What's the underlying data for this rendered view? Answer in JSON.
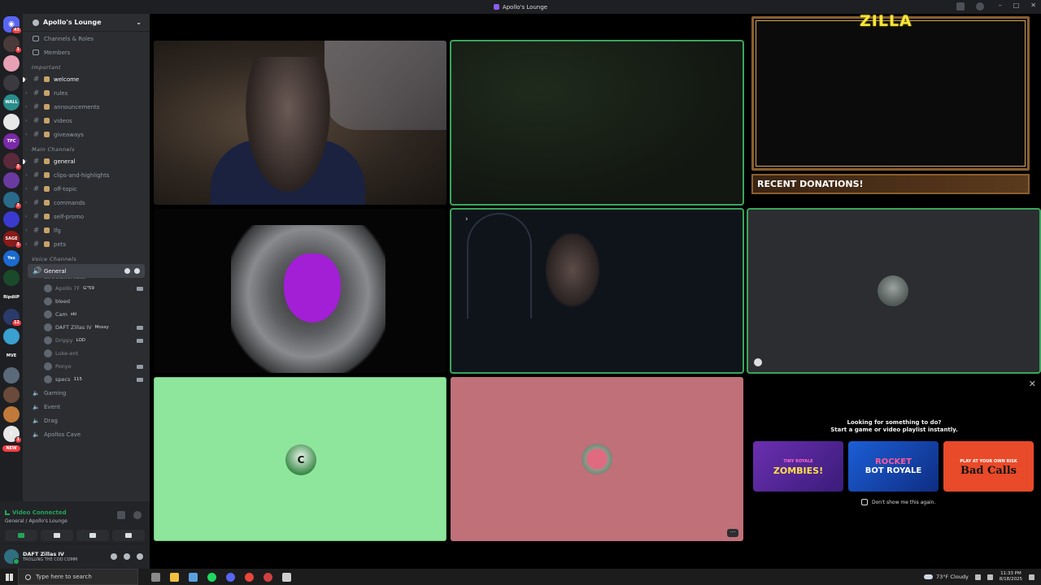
{
  "window": {
    "title": "Apollo's Lounge"
  },
  "server_rail": {
    "home_badge": "43",
    "items": [
      {
        "label": "",
        "badge": "1",
        "color": "#4b3a3a"
      },
      {
        "label": "",
        "badge": "",
        "color": "#e8a0b4"
      },
      {
        "label": "",
        "badge": "",
        "color": "#3a3a40"
      },
      {
        "label": "WALL",
        "badge": "",
        "color": "#2a8c8c"
      },
      {
        "label": "",
        "badge": "",
        "color": "#e8e8e8"
      },
      {
        "label": "TPC",
        "badge": "",
        "color": "#7a2aa8"
      },
      {
        "label": "",
        "badge": "3",
        "color": "#5a2a3a"
      },
      {
        "label": "",
        "badge": "",
        "color": "#6a3aa0"
      },
      {
        "label": "",
        "badge": "3",
        "color": "#2a6a8a"
      },
      {
        "label": "",
        "badge": "",
        "color": "#3a3ad0"
      },
      {
        "label": "SAGE",
        "badge": "3",
        "color": "#8a1a1a"
      },
      {
        "label": "Yes",
        "badge": "",
        "color": "#1a6ad0"
      },
      {
        "label": "",
        "badge": "",
        "color": "#1a4a2a"
      },
      {
        "label": "RipdiiP",
        "badge": "",
        "color": "#1e1f22"
      },
      {
        "label": "",
        "badge": "12",
        "color": "#2a3a6a"
      },
      {
        "label": "",
        "badge": "",
        "color": "#3aa0d0"
      },
      {
        "label": "MVE",
        "badge": "",
        "color": "#1e1f22"
      },
      {
        "label": "",
        "badge": "",
        "color": "#5a6a7a"
      },
      {
        "label": "",
        "badge": "",
        "color": "#6a4a3a"
      },
      {
        "label": "",
        "badge": "",
        "color": "#c07a3a"
      },
      {
        "label": "C",
        "badge": "1",
        "color": "#e8e8e8"
      }
    ],
    "new_label": "NEW"
  },
  "sidebar": {
    "guild_name": "Apollo's Lounge",
    "nav": [
      {
        "label": "Channels & Roles"
      },
      {
        "label": "Members"
      }
    ],
    "categories": {
      "important": "Important",
      "main": "Main Channels",
      "voice": "Voice Channels"
    },
    "important_channels": [
      {
        "label": "welcome",
        "unread": true
      },
      {
        "label": "rules",
        "unread": false
      },
      {
        "label": "announcements",
        "unread": false
      },
      {
        "label": "videos",
        "unread": false
      },
      {
        "label": "giveaways",
        "unread": false
      }
    ],
    "main_channels": [
      {
        "label": "general",
        "unread": true
      },
      {
        "label": "clips-and-highlights",
        "unread": false
      },
      {
        "label": "off-topic",
        "unread": false
      },
      {
        "label": "commands",
        "unread": false
      },
      {
        "label": "self-promo",
        "unread": false
      },
      {
        "label": "lfg",
        "unread": false
      },
      {
        "label": "pets",
        "unread": false
      }
    ],
    "voice_active": {
      "label": "General",
      "status": "Set a channel status"
    },
    "voice_users": [
      {
        "name": "Apollo 7F",
        "tag": "G\"59",
        "cam": true,
        "dim": true
      },
      {
        "name": "bleed",
        "tag": "",
        "cam": false,
        "dim": false
      },
      {
        "name": "Cam",
        "tag": "ski",
        "cam": false,
        "dim": false
      },
      {
        "name": "DAFT Zillas IV",
        "tag": "Mossy",
        "cam": true,
        "dim": false
      },
      {
        "name": "Drippy",
        "tag": "LOD",
        "cam": true,
        "dim": true
      },
      {
        "name": "Luke-ent",
        "tag": "",
        "cam": false,
        "dim": true
      },
      {
        "name": "Ponyo",
        "tag": "",
        "cam": true,
        "dim": true
      },
      {
        "name": "specs",
        "tag": "115",
        "cam": true,
        "dim": false
      }
    ],
    "voice_other": [
      {
        "label": "Gaming"
      },
      {
        "label": "Event"
      },
      {
        "label": "Drag"
      },
      {
        "label": "Apollos Cave"
      }
    ]
  },
  "rtc": {
    "status": "Video Connected",
    "location": "General / Apollo's Lounge"
  },
  "user": {
    "name": "DAFT Zillas IV",
    "status": "TROLLING THE COD COMM"
  },
  "overlay": {
    "brand": "ZILLA",
    "donations": "RECENT DONATIONS!"
  },
  "tiles": {
    "t6_letter": "C"
  },
  "activity": {
    "line1": "Looking for something to do?",
    "line2": "Start a game or video playlist instantly.",
    "games": [
      {
        "top": "TINY ROYALE",
        "title": "ZOMBIES!"
      },
      {
        "top": "ROCKET",
        "title": "BOT ROYALE"
      },
      {
        "top": "PLAY AT YOUR OWN RISK",
        "title": "Bad Calls"
      }
    ],
    "dont_show": "Don't show me this again."
  },
  "taskbar": {
    "search_placeholder": "Type here to search",
    "weather": "73°F  Cloudy",
    "time": "11:33 PM",
    "date": "8/18/2025"
  }
}
